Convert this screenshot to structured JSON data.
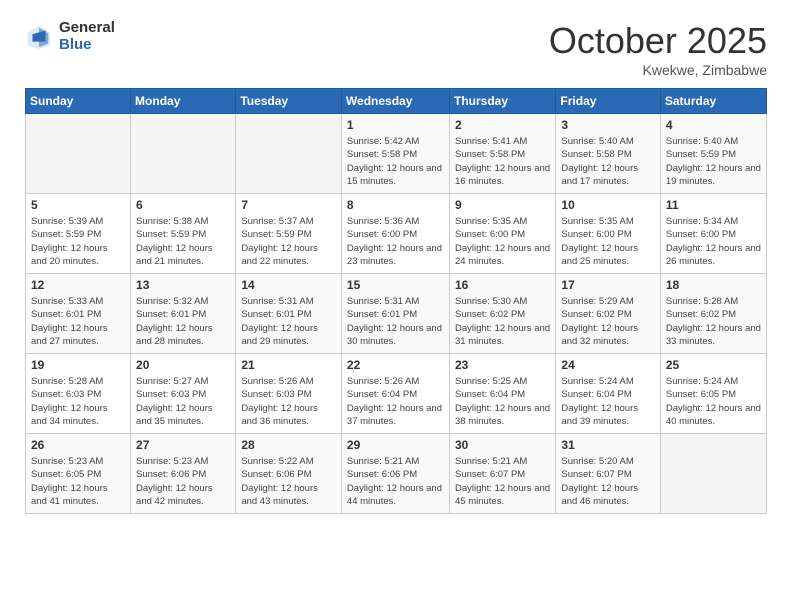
{
  "header": {
    "logo_general": "General",
    "logo_blue": "Blue",
    "month_title": "October 2025",
    "subtitle": "Kwekwe, Zimbabwe"
  },
  "days_of_week": [
    "Sunday",
    "Monday",
    "Tuesday",
    "Wednesday",
    "Thursday",
    "Friday",
    "Saturday"
  ],
  "weeks": [
    [
      {
        "day": "",
        "sunrise": "",
        "sunset": "",
        "daylight": ""
      },
      {
        "day": "",
        "sunrise": "",
        "sunset": "",
        "daylight": ""
      },
      {
        "day": "",
        "sunrise": "",
        "sunset": "",
        "daylight": ""
      },
      {
        "day": "1",
        "sunrise": "Sunrise: 5:42 AM",
        "sunset": "Sunset: 5:58 PM",
        "daylight": "Daylight: 12 hours and 15 minutes."
      },
      {
        "day": "2",
        "sunrise": "Sunrise: 5:41 AM",
        "sunset": "Sunset: 5:58 PM",
        "daylight": "Daylight: 12 hours and 16 minutes."
      },
      {
        "day": "3",
        "sunrise": "Sunrise: 5:40 AM",
        "sunset": "Sunset: 5:58 PM",
        "daylight": "Daylight: 12 hours and 17 minutes."
      },
      {
        "day": "4",
        "sunrise": "Sunrise: 5:40 AM",
        "sunset": "Sunset: 5:59 PM",
        "daylight": "Daylight: 12 hours and 19 minutes."
      }
    ],
    [
      {
        "day": "5",
        "sunrise": "Sunrise: 5:39 AM",
        "sunset": "Sunset: 5:59 PM",
        "daylight": "Daylight: 12 hours and 20 minutes."
      },
      {
        "day": "6",
        "sunrise": "Sunrise: 5:38 AM",
        "sunset": "Sunset: 5:59 PM",
        "daylight": "Daylight: 12 hours and 21 minutes."
      },
      {
        "day": "7",
        "sunrise": "Sunrise: 5:37 AM",
        "sunset": "Sunset: 5:59 PM",
        "daylight": "Daylight: 12 hours and 22 minutes."
      },
      {
        "day": "8",
        "sunrise": "Sunrise: 5:36 AM",
        "sunset": "Sunset: 6:00 PM",
        "daylight": "Daylight: 12 hours and 23 minutes."
      },
      {
        "day": "9",
        "sunrise": "Sunrise: 5:35 AM",
        "sunset": "Sunset: 6:00 PM",
        "daylight": "Daylight: 12 hours and 24 minutes."
      },
      {
        "day": "10",
        "sunrise": "Sunrise: 5:35 AM",
        "sunset": "Sunset: 6:00 PM",
        "daylight": "Daylight: 12 hours and 25 minutes."
      },
      {
        "day": "11",
        "sunrise": "Sunrise: 5:34 AM",
        "sunset": "Sunset: 6:00 PM",
        "daylight": "Daylight: 12 hours and 26 minutes."
      }
    ],
    [
      {
        "day": "12",
        "sunrise": "Sunrise: 5:33 AM",
        "sunset": "Sunset: 6:01 PM",
        "daylight": "Daylight: 12 hours and 27 minutes."
      },
      {
        "day": "13",
        "sunrise": "Sunrise: 5:32 AM",
        "sunset": "Sunset: 6:01 PM",
        "daylight": "Daylight: 12 hours and 28 minutes."
      },
      {
        "day": "14",
        "sunrise": "Sunrise: 5:31 AM",
        "sunset": "Sunset: 6:01 PM",
        "daylight": "Daylight: 12 hours and 29 minutes."
      },
      {
        "day": "15",
        "sunrise": "Sunrise: 5:31 AM",
        "sunset": "Sunset: 6:01 PM",
        "daylight": "Daylight: 12 hours and 30 minutes."
      },
      {
        "day": "16",
        "sunrise": "Sunrise: 5:30 AM",
        "sunset": "Sunset: 6:02 PM",
        "daylight": "Daylight: 12 hours and 31 minutes."
      },
      {
        "day": "17",
        "sunrise": "Sunrise: 5:29 AM",
        "sunset": "Sunset: 6:02 PM",
        "daylight": "Daylight: 12 hours and 32 minutes."
      },
      {
        "day": "18",
        "sunrise": "Sunrise: 5:28 AM",
        "sunset": "Sunset: 6:02 PM",
        "daylight": "Daylight: 12 hours and 33 minutes."
      }
    ],
    [
      {
        "day": "19",
        "sunrise": "Sunrise: 5:28 AM",
        "sunset": "Sunset: 6:03 PM",
        "daylight": "Daylight: 12 hours and 34 minutes."
      },
      {
        "day": "20",
        "sunrise": "Sunrise: 5:27 AM",
        "sunset": "Sunset: 6:03 PM",
        "daylight": "Daylight: 12 hours and 35 minutes."
      },
      {
        "day": "21",
        "sunrise": "Sunrise: 5:26 AM",
        "sunset": "Sunset: 6:03 PM",
        "daylight": "Daylight: 12 hours and 36 minutes."
      },
      {
        "day": "22",
        "sunrise": "Sunrise: 5:26 AM",
        "sunset": "Sunset: 6:04 PM",
        "daylight": "Daylight: 12 hours and 37 minutes."
      },
      {
        "day": "23",
        "sunrise": "Sunrise: 5:25 AM",
        "sunset": "Sunset: 6:04 PM",
        "daylight": "Daylight: 12 hours and 38 minutes."
      },
      {
        "day": "24",
        "sunrise": "Sunrise: 5:24 AM",
        "sunset": "Sunset: 6:04 PM",
        "daylight": "Daylight: 12 hours and 39 minutes."
      },
      {
        "day": "25",
        "sunrise": "Sunrise: 5:24 AM",
        "sunset": "Sunset: 6:05 PM",
        "daylight": "Daylight: 12 hours and 40 minutes."
      }
    ],
    [
      {
        "day": "26",
        "sunrise": "Sunrise: 5:23 AM",
        "sunset": "Sunset: 6:05 PM",
        "daylight": "Daylight: 12 hours and 41 minutes."
      },
      {
        "day": "27",
        "sunrise": "Sunrise: 5:23 AM",
        "sunset": "Sunset: 6:06 PM",
        "daylight": "Daylight: 12 hours and 42 minutes."
      },
      {
        "day": "28",
        "sunrise": "Sunrise: 5:22 AM",
        "sunset": "Sunset: 6:06 PM",
        "daylight": "Daylight: 12 hours and 43 minutes."
      },
      {
        "day": "29",
        "sunrise": "Sunrise: 5:21 AM",
        "sunset": "Sunset: 6:06 PM",
        "daylight": "Daylight: 12 hours and 44 minutes."
      },
      {
        "day": "30",
        "sunrise": "Sunrise: 5:21 AM",
        "sunset": "Sunset: 6:07 PM",
        "daylight": "Daylight: 12 hours and 45 minutes."
      },
      {
        "day": "31",
        "sunrise": "Sunrise: 5:20 AM",
        "sunset": "Sunset: 6:07 PM",
        "daylight": "Daylight: 12 hours and 46 minutes."
      },
      {
        "day": "",
        "sunrise": "",
        "sunset": "",
        "daylight": ""
      }
    ]
  ]
}
